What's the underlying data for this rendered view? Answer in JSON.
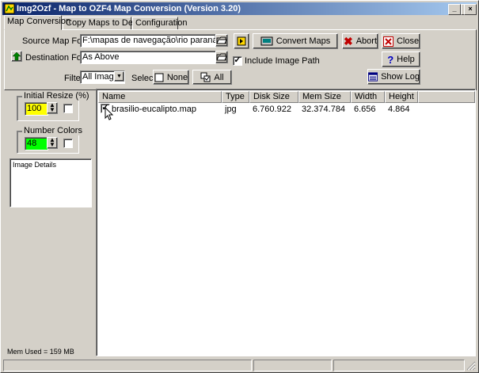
{
  "window": {
    "title": "Img2Ozf - Map to OZF4 Map Conversion (Version 3.20)",
    "controls": {
      "minimize": "_",
      "maximize": "□",
      "close": "×"
    }
  },
  "tabs": [
    {
      "label": "Map Conversion",
      "active": true
    },
    {
      "label": "Copy Maps to Device",
      "active": false
    },
    {
      "label": "Configuration",
      "active": false
    }
  ],
  "form": {
    "source_label": "Source Map Folder",
    "source_value": "F:\\mapas de navegação\\rio paraná\\brasilio-e",
    "dest_label": "Destination Folder",
    "dest_value": "As Above",
    "filter_label": "Filter",
    "filter_value": "All Images",
    "select_label": "Select",
    "none_button": "None",
    "all_button": "All",
    "include_image_path_label": "Include Image Path",
    "include_image_path_checked": true
  },
  "buttons": {
    "convert": "Convert Maps",
    "abort": "Abort",
    "close": "Close",
    "help": "Help",
    "show_log": "Show Log"
  },
  "left_panel": {
    "initial_resize_label": "Initial Resize (%)",
    "initial_resize_value": "100",
    "initial_resize_color": "#ffff00",
    "number_colors_label": "Number Colors",
    "number_colors_value": "48",
    "number_colors_color": "#00ff00",
    "image_details_label": "Image Details",
    "mem_used": "Mem Used = 159 MB"
  },
  "file_list": {
    "columns": [
      "Name",
      "Type",
      "Disk Size",
      "Mem Size",
      "Width",
      "Height"
    ],
    "rows": [
      {
        "checked": true,
        "name": "brasilio-eucalipto.map",
        "type": "jpg",
        "disk_size": "6.760.922",
        "mem_size": "32.374.784",
        "width": "6.656",
        "height": "4.864"
      }
    ]
  }
}
